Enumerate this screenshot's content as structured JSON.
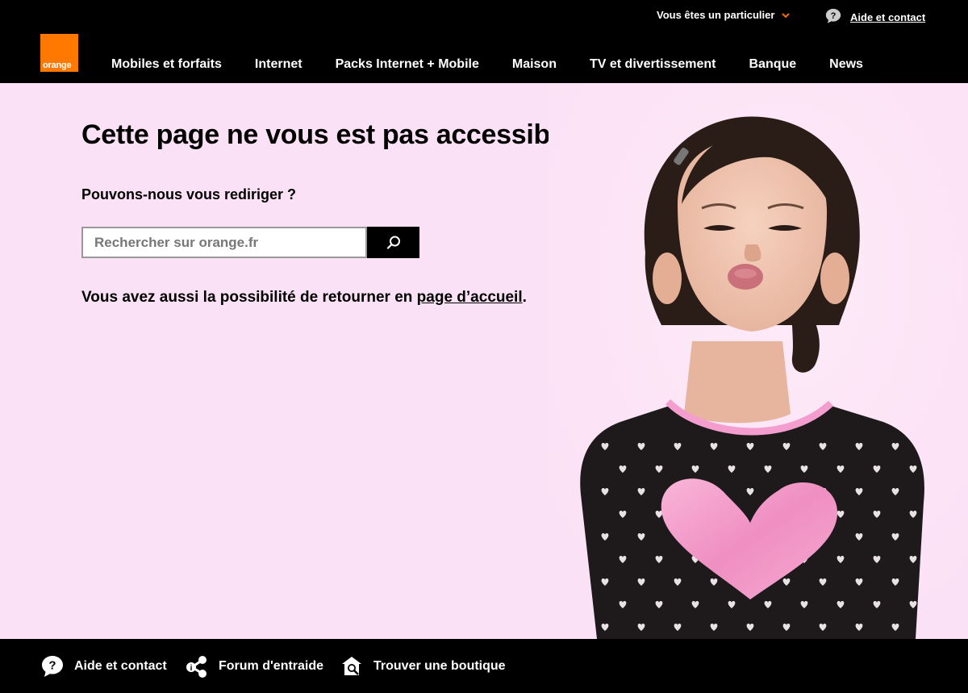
{
  "header": {
    "customer_selector": "Vous êtes un particulier",
    "help_link": "Aide et contact",
    "logo_text": "orange",
    "brand_color": "#ff7900",
    "accent_chevron_color": "#f16e00",
    "nav": [
      {
        "label": "Mobiles et forfaits"
      },
      {
        "label": "Internet"
      },
      {
        "label": "Packs Internet + Mobile"
      },
      {
        "label": "Maison"
      },
      {
        "label": "TV et divertissement"
      },
      {
        "label": "Banque"
      },
      {
        "label": "News"
      }
    ]
  },
  "main": {
    "title": "Cette page ne vous est pas accessible.",
    "subtitle": "Pouvons-nous vous rediriger ?",
    "search": {
      "placeholder": "Rechercher sur orange.fr",
      "value": ""
    },
    "return_text_before": "Vous avez aussi la possibilité de retourner en ",
    "return_link": "page d’accueil",
    "return_text_after": ".",
    "background_color": "#fbe1f5"
  },
  "footer": {
    "items": [
      {
        "label": "Aide et contact",
        "icon": "question-bubble-icon"
      },
      {
        "label": "Forum d'entraide",
        "icon": "share-nodes-icon"
      },
      {
        "label": "Trouver une boutique",
        "icon": "store-locator-icon"
      }
    ]
  }
}
